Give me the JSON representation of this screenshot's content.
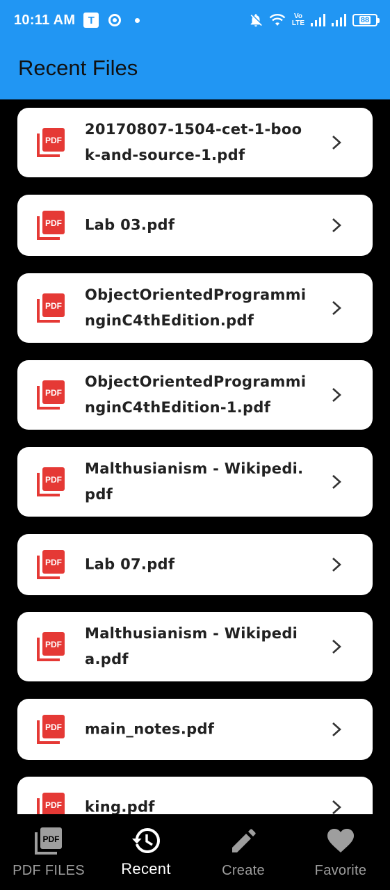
{
  "status_bar": {
    "time": "10:11 AM",
    "t_badge": "T",
    "network": "Vo LTE",
    "battery": "88"
  },
  "app_bar": {
    "title": "Recent Files"
  },
  "files": [
    {
      "name": "20170807-1504-cet-1-book-and-source-1.pdf"
    },
    {
      "name": "Lab 03.pdf"
    },
    {
      "name": "ObjectOrientedProgramminginC4thEdition.pdf"
    },
    {
      "name": "ObjectOrientedProgramminginC4thEdition-1.pdf"
    },
    {
      "name": "Malthusianism - Wikipedi.pdf"
    },
    {
      "name": "Lab 07.pdf"
    },
    {
      "name": "Malthusianism - Wikipedia.pdf"
    },
    {
      "name": "main_notes.pdf"
    },
    {
      "name": "king.pdf"
    }
  ],
  "icons": {
    "file": "picture-as-pdf-icon",
    "chevron": "chevron-right-icon"
  },
  "bottom_nav": {
    "items": [
      {
        "label": "PDF FILES",
        "icon": "picture-as-pdf-icon",
        "active": false
      },
      {
        "label": "Recent",
        "icon": "history-icon",
        "active": true
      },
      {
        "label": "Create",
        "icon": "edit-pencil-icon",
        "active": false
      },
      {
        "label": "Favorite",
        "icon": "heart-icon",
        "active": false
      }
    ]
  },
  "colors": {
    "app_bar": "#2196f3",
    "background": "#000000",
    "card": "#ffffff",
    "pdf_icon": "#e53935",
    "nav_active": "#ffffff",
    "nav_inactive": "#9e9e9e"
  }
}
